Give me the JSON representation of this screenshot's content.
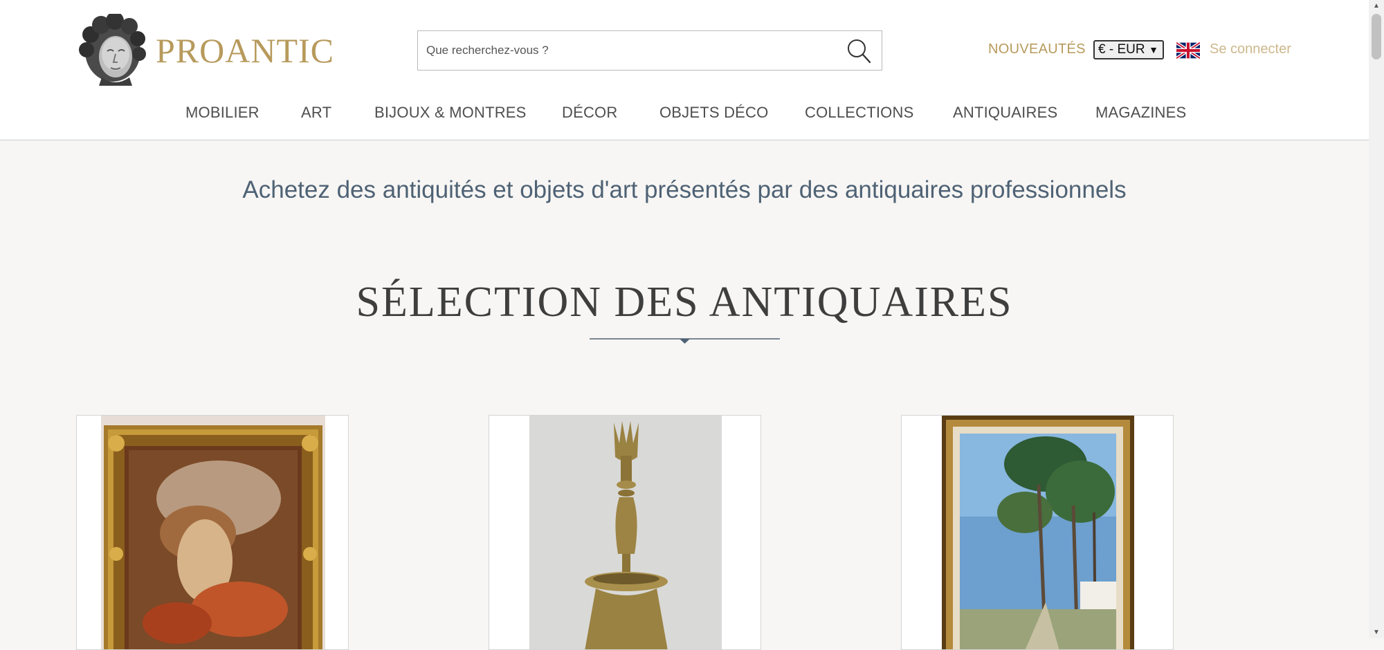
{
  "header": {
    "brand": "PROANTIC",
    "search_placeholder": "Que recherchez-vous ?",
    "new_items": "NOUVEAUTÉS",
    "currency": "€ - EUR",
    "login": "Se connecter",
    "language_flag": "uk-flag-icon"
  },
  "nav": {
    "items": [
      {
        "label": "MOBILIER"
      },
      {
        "label": "ART"
      },
      {
        "label": "BIJOUX & MONTRES"
      },
      {
        "label": "DÉCOR"
      },
      {
        "label": "OBJETS DÉCO"
      },
      {
        "label": "COLLECTIONS"
      },
      {
        "label": "ANTIQUAIRES"
      },
      {
        "label": "MAGAZINES"
      }
    ]
  },
  "main": {
    "tagline": "Achetez des antiquités et objets d'art présentés par des antiquaires professionnels",
    "section_title": "SÉLECTION DES ANTIQUAIRES"
  },
  "colors": {
    "gold": "#b79a5c",
    "nav_text": "#4e4e4e",
    "tagline": "#4f6275",
    "background": "#f7f6f4"
  }
}
